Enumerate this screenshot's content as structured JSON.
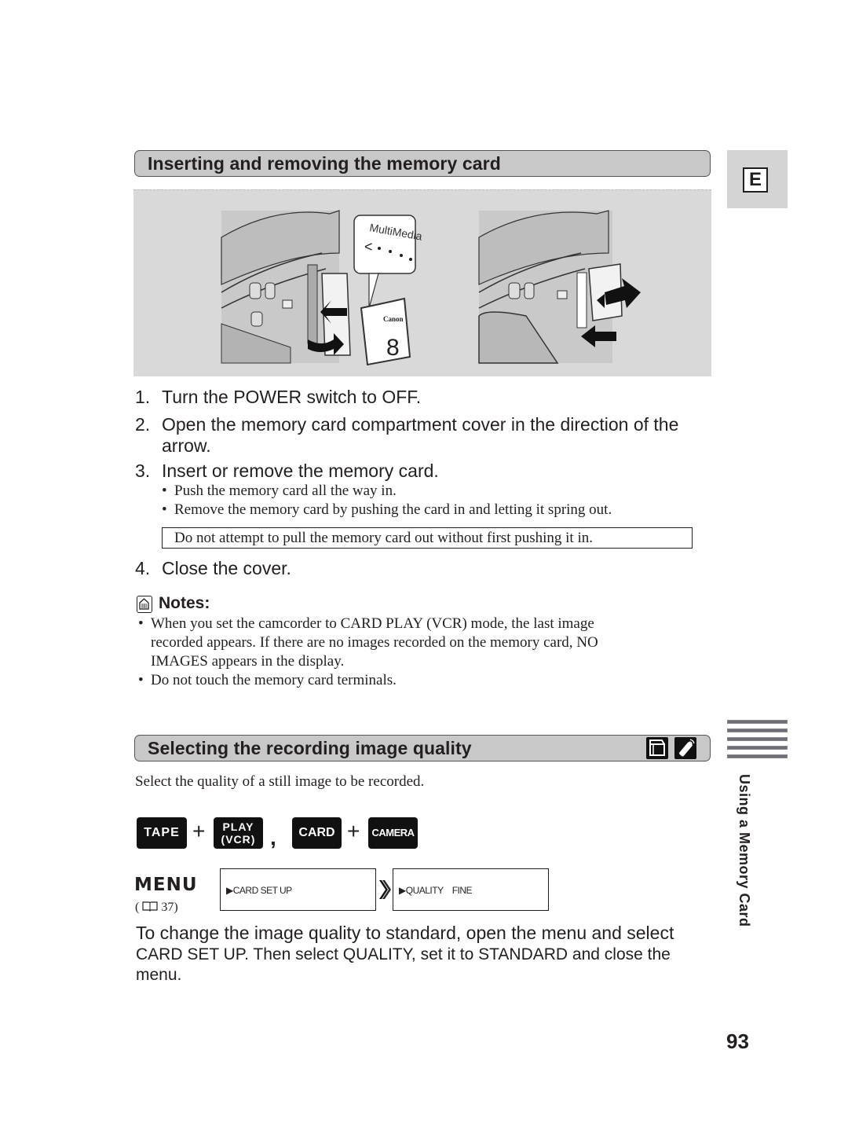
{
  "page": {
    "language_tab": "E",
    "page_number": "93",
    "side_label": "Using a Memory Card"
  },
  "section1": {
    "title": "Inserting and removing the memory card",
    "illustration": {
      "callout_label": "MultiMedia",
      "card_brand": "Canon",
      "card_capacity": "8"
    },
    "steps": [
      {
        "num": "1.",
        "text": "Turn the POWER switch to OFF."
      },
      {
        "num": "2.",
        "text": "Open the memory card compartment cover in the direction of the",
        "cont": "arrow."
      },
      {
        "num": "3.",
        "text": "Insert or remove the memory card."
      },
      {
        "num": "4.",
        "text": "Close the cover."
      }
    ],
    "bullets": [
      "Push the memory card all the way in.",
      "Remove the memory card by pushing the card in and letting it spring out."
    ],
    "caution": "Do not attempt to pull the memory card out without first pushing it in.",
    "notes_title": "Notes:",
    "notes": [
      {
        "line1": "When you set the camcorder to CARD PLAY (VCR) mode, the last image",
        "line2": "recorded appears. If there are no images recorded on the memory card, NO",
        "line3": "IMAGES appears in the display."
      },
      {
        "line1": "Do not touch the memory card terminals."
      }
    ]
  },
  "section2": {
    "title": "Selecting the recording image quality",
    "header_icons": [
      "camcorder-icon",
      "remote-control-icon"
    ],
    "intro": "Select the quality of a still image to be recorded.",
    "modes": {
      "tape": "TAPE",
      "plus": "+",
      "play_line1": "PLAY",
      "play_line2": "(VCR)",
      "comma": ",",
      "card": "CARD",
      "camera": "CAMERA"
    },
    "menu": {
      "label": "MENU",
      "ref_open": "(",
      "ref_page": "37)",
      "box1": "▶CARD SET UP",
      "box2": "▶QUALITY    FINE"
    },
    "instruction": {
      "line1": "To change the image quality to standard, open the menu and select",
      "line2": "CARD SET UP. Then select QUALITY, set it to STANDARD and close the",
      "line3": "menu."
    }
  }
}
